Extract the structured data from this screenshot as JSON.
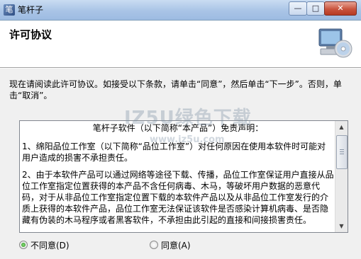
{
  "window": {
    "title": "笔杆子",
    "app_icon_glyph": "笔",
    "minimize_glyph": "—",
    "maximize_glyph": "□",
    "close_glyph": "✕"
  },
  "header": {
    "title": "许可协议",
    "art_icon": "computer-cd-icon"
  },
  "instruction": "现在请阅读此许可协议。如接受以下条款，请单击“同意”，然后单击“下一步”。否则，单击“取消”。",
  "license": {
    "heading": "笔杆子软件（以下简称“本产品”）免责声明：",
    "paragraphs": [
      "1、绵阳品位工作室（以下简称“品位工作室”）对任何原因在使用本软件时可能对用户造成的损害不承担责任。",
      "2、由于本软件产品可以通过网络等途径下载、传播，品位工作室保证用户直接从品位工作室指定位置获得的本产品不含任何病毒、木马，等破坏用户数据的恶意代码，对于从非品位工作室指定位置下载的本软件产品以及从非品位工作室发行的介质上获得的本软件产品，品位工作室无法保证该软件是否感染计算机病毒、是否隐藏有伪装的木马程序或者黑客软件，不承担由此引起的直接和间接损害责任。"
    ],
    "scroll_up_glyph": "▲",
    "scroll_down_glyph": "▼"
  },
  "options": {
    "disagree_label": "不同意(D)",
    "agree_label": "同意(A)",
    "selected": "disagree"
  },
  "watermark": {
    "main": "IZ5U绿色下载",
    "sub": "www.iz5u.com"
  }
}
